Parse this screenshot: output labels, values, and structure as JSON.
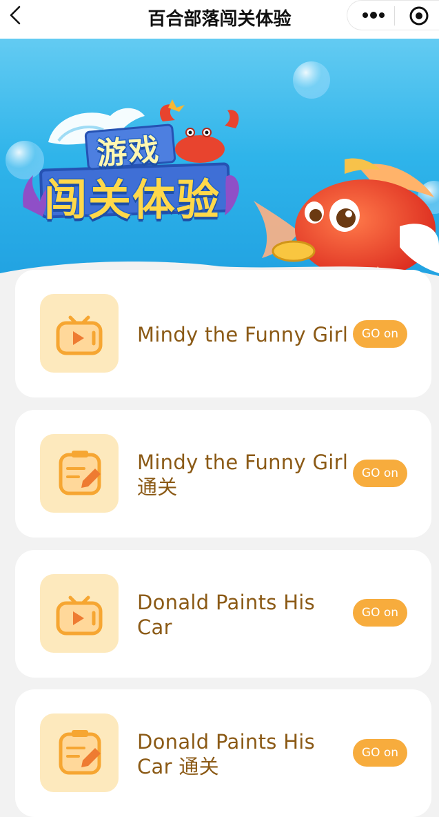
{
  "navbar": {
    "title": "百合部落闯关体验",
    "back_icon": "chevron-left-icon",
    "more_icon": "more-dots-icon",
    "close_icon": "target-circle-icon"
  },
  "banner": {
    "line1": "游戏",
    "line2": "闯关体验"
  },
  "colors": {
    "accent": "#f7ac3d",
    "title_text": "#8b5a16",
    "icon_tile": "#fde9bd",
    "banner_blue": "#2fb4ea"
  },
  "cards": [
    {
      "icon": "tv-video-icon",
      "title": "Mindy the Funny Girl",
      "button": "GO on"
    },
    {
      "icon": "notepad-pencil-icon",
      "title": "Mindy the Funny Girl 通关",
      "button": "GO on"
    },
    {
      "icon": "tv-video-icon",
      "title": "Donald Paints His Car",
      "button": "GO on"
    },
    {
      "icon": "notepad-pencil-icon",
      "title": "Donald Paints His Car 通关",
      "button": "GO on"
    }
  ]
}
